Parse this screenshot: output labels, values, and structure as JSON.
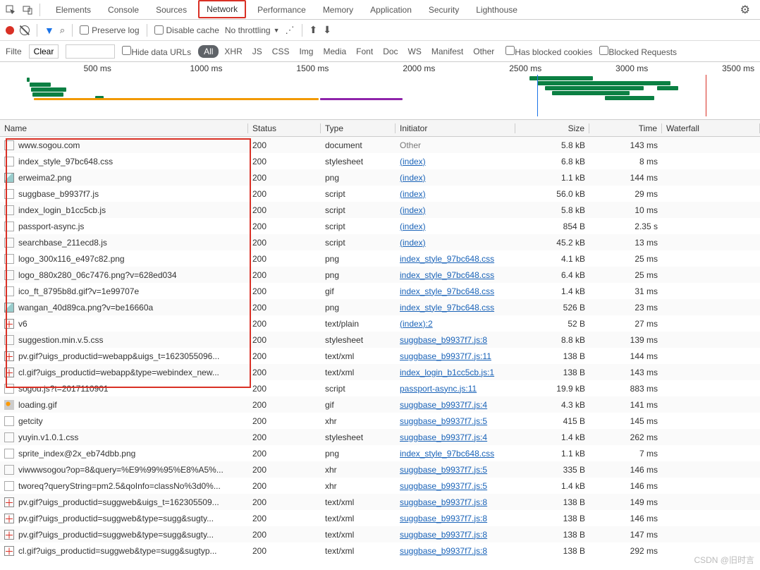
{
  "tabs": [
    "Elements",
    "Console",
    "Sources",
    "Network",
    "Performance",
    "Memory",
    "Application",
    "Security",
    "Lighthouse"
  ],
  "activeTab": "Network",
  "toolbar": {
    "preserveLog": "Preserve log",
    "disableCache": "Disable cache",
    "throttling": "No throttling"
  },
  "filter": {
    "label": "Filte",
    "clear": "Clear",
    "hideData": "Hide data URLs",
    "cats": [
      "All",
      "XHR",
      "JS",
      "CSS",
      "Img",
      "Media",
      "Font",
      "Doc",
      "WS",
      "Manifest",
      "Other"
    ],
    "hasBlocked": "Has blocked cookies",
    "blockedReq": "Blocked Requests"
  },
  "overview": {
    "ticks": [
      "500 ms",
      "1000 ms",
      "1500 ms",
      "2000 ms",
      "2500 ms",
      "3000 ms",
      "3500 ms"
    ]
  },
  "headers": {
    "name": "Name",
    "status": "Status",
    "type": "Type",
    "init": "Initiator",
    "size": "Size",
    "time": "Time",
    "wf": "Waterfall"
  },
  "rows": [
    {
      "ic": "doc",
      "name": "www.sogou.com",
      "status": "200",
      "type": "document",
      "init": "Other",
      "il": false,
      "size": "5.8 kB",
      "time": "143 ms",
      "wf": [
        {
          "l": 1,
          "w": 3,
          "c": "g2"
        }
      ]
    },
    {
      "ic": "doc",
      "name": "index_style_97bc648.css",
      "status": "200",
      "type": "stylesheet",
      "init": "(index)",
      "il": true,
      "size": "6.8 kB",
      "time": "8 ms",
      "wf": [
        {
          "l": 3,
          "w": 1,
          "c": "b"
        }
      ]
    },
    {
      "ic": "img",
      "name": "erweima2.png",
      "status": "200",
      "type": "png",
      "init": "(index)",
      "il": true,
      "size": "1.1 kB",
      "time": "144 ms",
      "wf": [
        {
          "l": 3,
          "w": 4,
          "c": "g2"
        }
      ]
    },
    {
      "ic": "doc",
      "name": "suggbase_b9937f7.js",
      "status": "200",
      "type": "script",
      "init": "(index)",
      "il": true,
      "size": "56.0 kB",
      "time": "29 ms",
      "wf": [
        {
          "l": 3,
          "w": 1,
          "c": "b"
        }
      ]
    },
    {
      "ic": "doc",
      "name": "index_login_b1cc5cb.js",
      "status": "200",
      "type": "script",
      "init": "(index)",
      "il": true,
      "size": "5.8 kB",
      "time": "10 ms",
      "wf": [
        {
          "l": 3,
          "w": 1,
          "c": "b"
        }
      ]
    },
    {
      "ic": "doc",
      "name": "passport-async.js",
      "status": "200",
      "type": "script",
      "init": "(index)",
      "il": true,
      "size": "854 B",
      "time": "2.35 s",
      "wf": [
        {
          "l": 3,
          "w": 60,
          "c": "o"
        },
        {
          "l": 63,
          "w": 10,
          "c": "p"
        },
        {
          "l": 73,
          "w": 5,
          "c": ""
        }
      ]
    },
    {
      "ic": "doc",
      "name": "searchbase_211ecd8.js",
      "status": "200",
      "type": "script",
      "init": "(index)",
      "il": true,
      "size": "45.2 kB",
      "time": "13 ms",
      "wf": [
        {
          "l": 3,
          "w": 1,
          "c": "b"
        }
      ]
    },
    {
      "ic": "doc",
      "name": "logo_300x116_e497c82.png",
      "status": "200",
      "type": "png",
      "init": "index_style_97bc648.css",
      "il": true,
      "size": "4.1 kB",
      "time": "25 ms",
      "wf": [
        {
          "l": 4,
          "w": 1,
          "c": "b"
        }
      ]
    },
    {
      "ic": "doc",
      "name": "logo_880x280_06c7476.png?v=628ed034",
      "status": "200",
      "type": "png",
      "init": "index_style_97bc648.css",
      "il": true,
      "size": "6.4 kB",
      "time": "25 ms",
      "wf": [
        {
          "l": 4,
          "w": 1,
          "c": "b"
        }
      ]
    },
    {
      "ic": "doc",
      "name": "ico_ft_8795b8d.gif?v=1e99707e",
      "status": "200",
      "type": "gif",
      "init": "index_style_97bc648.css",
      "il": true,
      "size": "1.4 kB",
      "time": "31 ms",
      "wf": [
        {
          "l": 4,
          "w": 1,
          "c": "b"
        }
      ]
    },
    {
      "ic": "img",
      "name": "wangan_40d89ca.png?v=be16660a",
      "status": "200",
      "type": "png",
      "init": "index_style_97bc648.css",
      "il": true,
      "size": "526 B",
      "time": "23 ms",
      "wf": [
        {
          "l": 4,
          "w": 1,
          "c": "b"
        }
      ]
    },
    {
      "ic": "brk",
      "name": "v6",
      "status": "200",
      "type": "text/plain",
      "init": "(index):2",
      "il": true,
      "size": "52 B",
      "time": "27 ms",
      "wf": [
        {
          "l": 4,
          "w": 1,
          "c": "b"
        }
      ]
    },
    {
      "ic": "doc",
      "name": "suggestion.min.v.5.css",
      "status": "200",
      "type": "stylesheet",
      "init": "suggbase_b9937f7.js:8",
      "il": true,
      "size": "8.8 kB",
      "time": "139 ms",
      "wf": [
        {
          "l": 5,
          "w": 4,
          "c": "g2"
        }
      ]
    },
    {
      "ic": "brk",
      "name": "pv.gif?uigs_productid=webapp&uigs_t=1623055096...",
      "status": "200",
      "type": "text/xml",
      "init": "suggbase_b9937f7.js:11",
      "il": true,
      "size": "138 B",
      "time": "144 ms",
      "wf": [
        {
          "l": 5,
          "w": 4,
          "c": "g2"
        }
      ]
    },
    {
      "ic": "brk",
      "name": "cl.gif?uigs_productid=webapp&type=webindex_new...",
      "status": "200",
      "type": "text/xml",
      "init": "index_login_b1cc5cb.js:1",
      "il": true,
      "size": "138 B",
      "time": "143 ms",
      "wf": [
        {
          "l": 5,
          "w": 4,
          "c": "g2"
        }
      ]
    },
    {
      "ic": "doc",
      "name": "sogou.js?t=2017110901",
      "status": "200",
      "type": "script",
      "init": "passport-async.js:11",
      "il": true,
      "size": "19.9 kB",
      "time": "883 ms",
      "wf": []
    },
    {
      "ic": "simg",
      "name": "loading.gif",
      "status": "200",
      "type": "gif",
      "init": "suggbase_b9937f7.js:4",
      "il": true,
      "size": "4.3 kB",
      "time": "141 ms",
      "wf": []
    },
    {
      "ic": "doc",
      "name": "getcity",
      "status": "200",
      "type": "xhr",
      "init": "suggbase_b9937f7.js:5",
      "il": true,
      "size": "415 B",
      "time": "145 ms",
      "wf": []
    },
    {
      "ic": "doc",
      "name": "yuyin.v1.0.1.css",
      "status": "200",
      "type": "stylesheet",
      "init": "suggbase_b9937f7.js:4",
      "il": true,
      "size": "1.4 kB",
      "time": "262 ms",
      "wf": []
    },
    {
      "ic": "doc",
      "name": "sprite_index@2x_eb74dbb.png",
      "status": "200",
      "type": "png",
      "init": "index_style_97bc648.css",
      "il": true,
      "size": "1.1 kB",
      "time": "7 ms",
      "wf": []
    },
    {
      "ic": "doc",
      "name": "viwwwsogou?op=8&query=%E9%99%95%E8%A5%...",
      "status": "200",
      "type": "xhr",
      "init": "suggbase_b9937f7.js:5",
      "il": true,
      "size": "335 B",
      "time": "146 ms",
      "wf": []
    },
    {
      "ic": "doc",
      "name": "tworeq?queryString=pm2.5&qoInfo=classNo%3d0%...",
      "status": "200",
      "type": "xhr",
      "init": "suggbase_b9937f7.js:5",
      "il": true,
      "size": "1.4 kB",
      "time": "146 ms",
      "wf": []
    },
    {
      "ic": "brk",
      "name": "pv.gif?uigs_productid=suggweb&uigs_t=162305509...",
      "status": "200",
      "type": "text/xml",
      "init": "suggbase_b9937f7.js:8",
      "il": true,
      "size": "138 B",
      "time": "149 ms",
      "wf": []
    },
    {
      "ic": "brk",
      "name": "pv.gif?uigs_productid=suggweb&type=sugg&sugty...",
      "status": "200",
      "type": "text/xml",
      "init": "suggbase_b9937f7.js:8",
      "il": true,
      "size": "138 B",
      "time": "146 ms",
      "wf": []
    },
    {
      "ic": "brk",
      "name": "pv.gif?uigs_productid=suggweb&type=sugg&sugty...",
      "status": "200",
      "type": "text/xml",
      "init": "suggbase_b9937f7.js:8",
      "il": true,
      "size": "138 B",
      "time": "147 ms",
      "wf": []
    },
    {
      "ic": "brk",
      "name": "cl.gif?uigs_productid=suggweb&type=sugg&sugtyp...",
      "status": "200",
      "type": "text/xml",
      "init": "suggbase_b9937f7.js:8",
      "il": true,
      "size": "138 B",
      "time": "292 ms",
      "wf": []
    }
  ],
  "watermark": "CSDN @旧时言"
}
